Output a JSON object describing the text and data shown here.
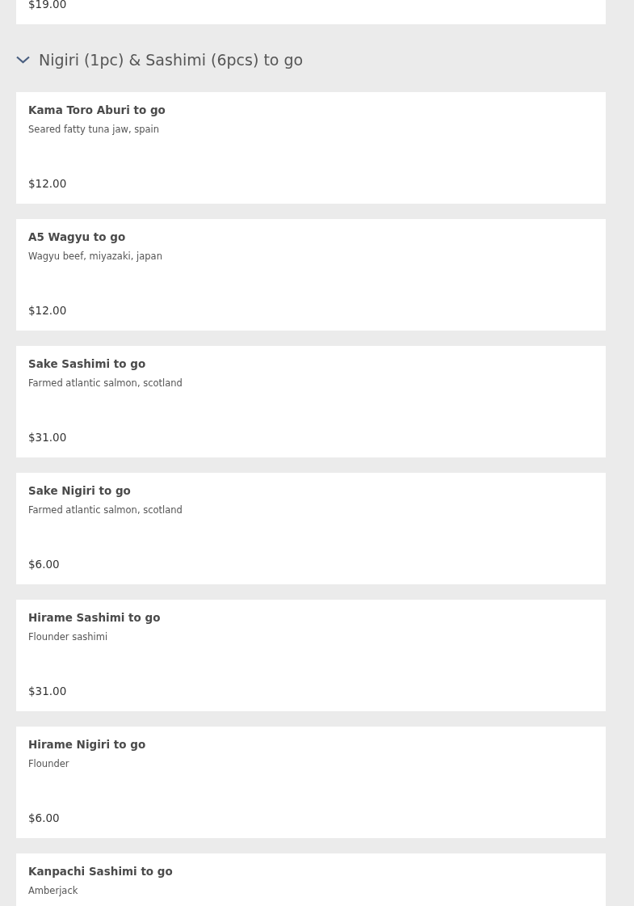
{
  "previous_item": {
    "price": "$19.00"
  },
  "section": {
    "title": "Nigiri (1pc) & Sashimi (6pcs) to go",
    "expanded": true,
    "items": [
      {
        "name": "Kama Toro Aburi to go",
        "description": "Seared fatty tuna jaw, spain",
        "price": "$12.00"
      },
      {
        "name": "A5 Wagyu to go",
        "description": "Wagyu beef, miyazaki, japan",
        "price": "$12.00"
      },
      {
        "name": "Sake Sashimi to go",
        "description": "Farmed atlantic salmon, scotland",
        "price": "$31.00"
      },
      {
        "name": "Sake Nigiri to go",
        "description": "Farmed atlantic salmon, scotland",
        "price": "$6.00"
      },
      {
        "name": "Hirame Sashimi to go",
        "description": "Flounder sashimi",
        "price": "$31.00"
      },
      {
        "name": "Hirame Nigiri to go",
        "description": "Flounder",
        "price": "$6.00"
      },
      {
        "name": "Kanpachi Sashimi to go",
        "description": "Amberjack"
      }
    ]
  }
}
